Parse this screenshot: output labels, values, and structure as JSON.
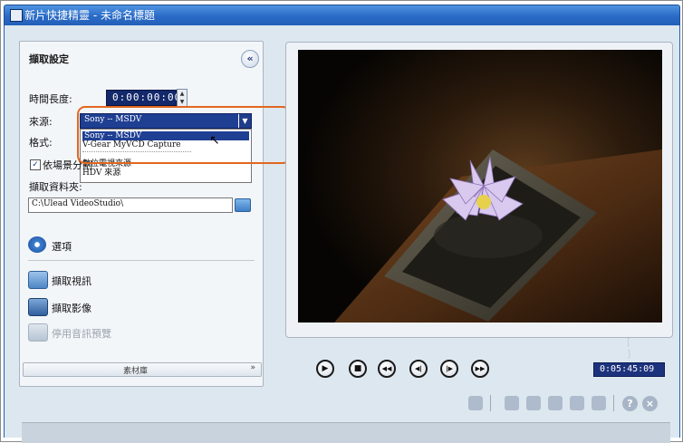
{
  "window": {
    "title": "新片快捷精靈 - 未命名標題"
  },
  "capture_panel": {
    "title": "擷取設定",
    "collapse_icon": "double-chevron-left-icon",
    "duration_label": "時間長度:",
    "duration_value": "0:00:00:00",
    "source_label": "來源:",
    "source_value": "Sony -- MSDV",
    "format_label": "格式:",
    "source_options": [
      "Sony -- MSDV",
      "V-Gear MyVCD Capture",
      "數位電視來源",
      "HDV 來源"
    ],
    "split_by_scene_label": "依場景分割",
    "split_by_scene_checked": true,
    "capture_folder_label": "擷取資料夾:",
    "capture_folder_value": "C:\\Ulead VideoStudio\\",
    "options_label": "選項",
    "capture_video_label": "擷取視訊",
    "capture_image_label": "擷取影像",
    "disable_audio_preview_label": "停用音訊預覽",
    "library_label": "素材庫",
    "library_expand": "»"
  },
  "preview": {
    "timecode": "0:05:45:09",
    "marker_glyphs": "[ ]",
    "controls": [
      {
        "name": "play",
        "glyph": "▶"
      },
      {
        "name": "stop",
        "glyph": "■"
      },
      {
        "name": "rewind",
        "glyph": "◀◀"
      },
      {
        "name": "prev-frame",
        "glyph": "◀|"
      },
      {
        "name": "next-frame",
        "glyph": "|▶"
      },
      {
        "name": "fast-forward",
        "glyph": "▶▶"
      }
    ]
  },
  "help": {
    "help_glyph": "?",
    "close_glyph": "×"
  },
  "colors": {
    "accent_highlight": "#e2671f",
    "titlebar": "#2a6bc7",
    "select_bg": "#1f3f93"
  }
}
